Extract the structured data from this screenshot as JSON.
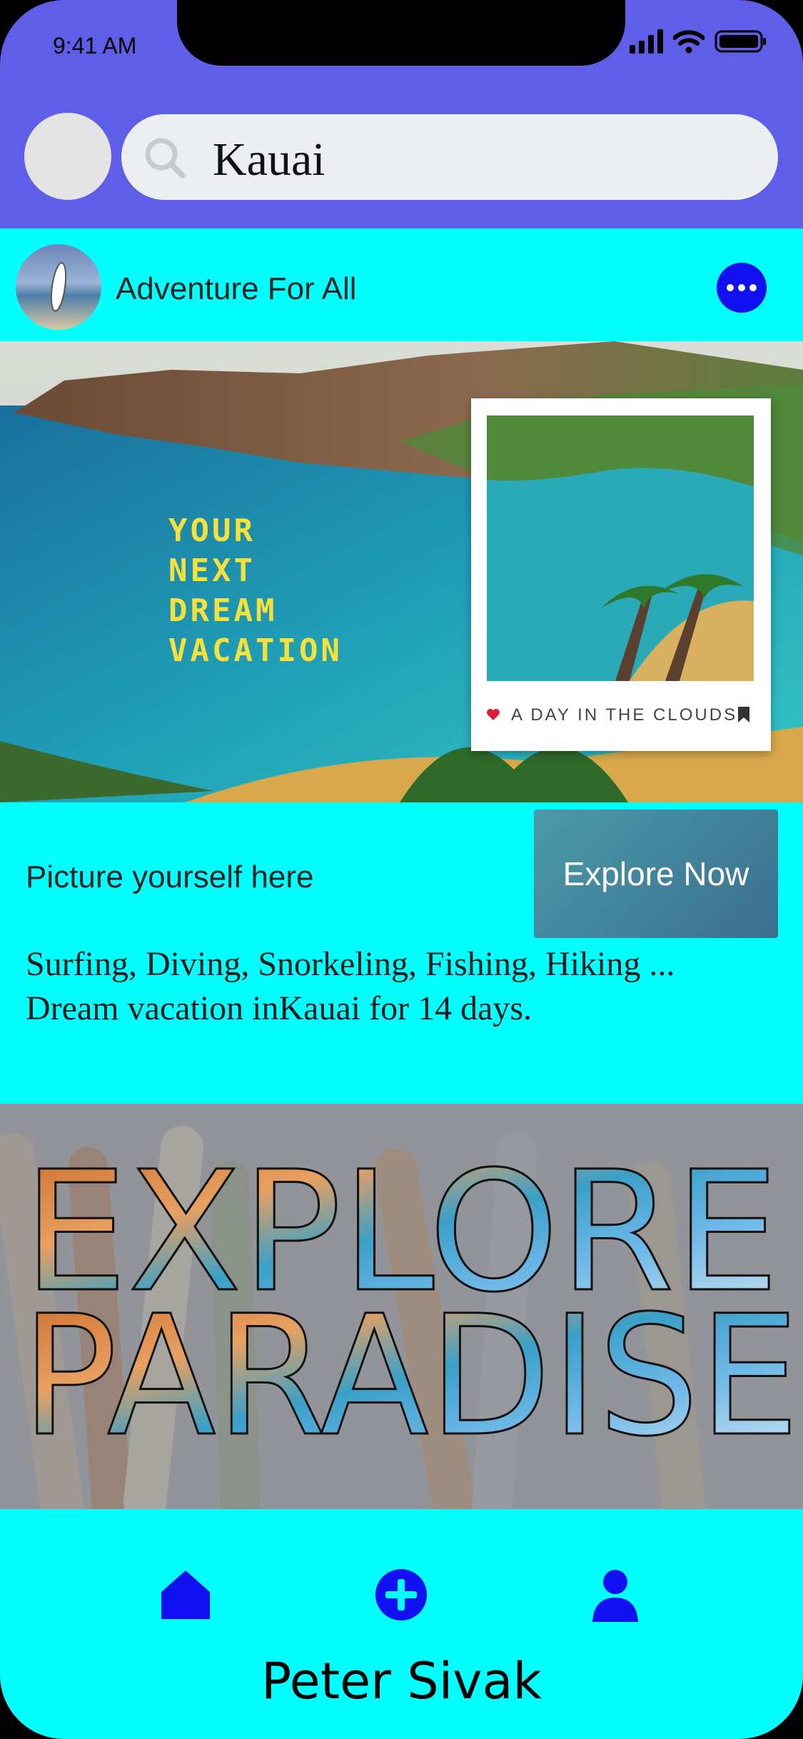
{
  "status_bar": {
    "time": "9:41 AM"
  },
  "search": {
    "query": "Kauai"
  },
  "post": {
    "author": "Adventure For All",
    "headline_lines": [
      "YOUR",
      "NEXT",
      "DREAM",
      "VACATION"
    ],
    "polaroid_caption": "A DAY IN THE CLOUDS",
    "subtitle": "Picture yourself here",
    "cta_label": "Explore Now",
    "description_line1": "Surfing, Diving, Snorkeling, Fishing, Hiking ...",
    "description_line2": "Dream vacation inKauai for 14 days."
  },
  "banner": {
    "line1": "EXPLORE",
    "line2": "PARADISE"
  },
  "bottom_nav": {
    "items": [
      {
        "icon": "home-icon"
      },
      {
        "icon": "add-circle-icon"
      },
      {
        "icon": "person-icon"
      }
    ],
    "user_name": "Peter Sivak"
  },
  "colors": {
    "header_bg": "#5f5ee8",
    "card_bg": "#00ffff",
    "nav_icon": "#1010f0",
    "headline": "#f6e03a"
  }
}
